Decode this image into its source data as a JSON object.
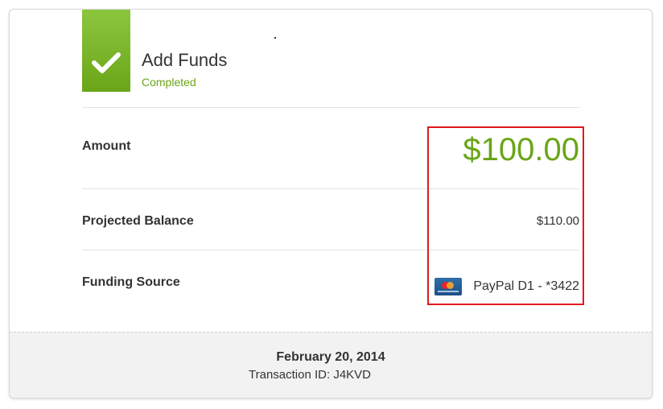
{
  "header": {
    "title": "Add Funds",
    "status": "Completed"
  },
  "details": {
    "amount_label": "Amount",
    "amount_value": "$100.00",
    "balance_label": "Projected Balance",
    "balance_value": "$110.00",
    "source_label": "Funding Source",
    "source_value": "PayPal D1 - *3422"
  },
  "footer": {
    "date": "February 20, 2014",
    "transaction": "Transaction ID: J4KVD"
  },
  "colors": {
    "accent": "#6aa518",
    "highlight": "#e0191e"
  },
  "icons": {
    "banner": "checkmark-icon",
    "card": "credit-card-icon"
  }
}
